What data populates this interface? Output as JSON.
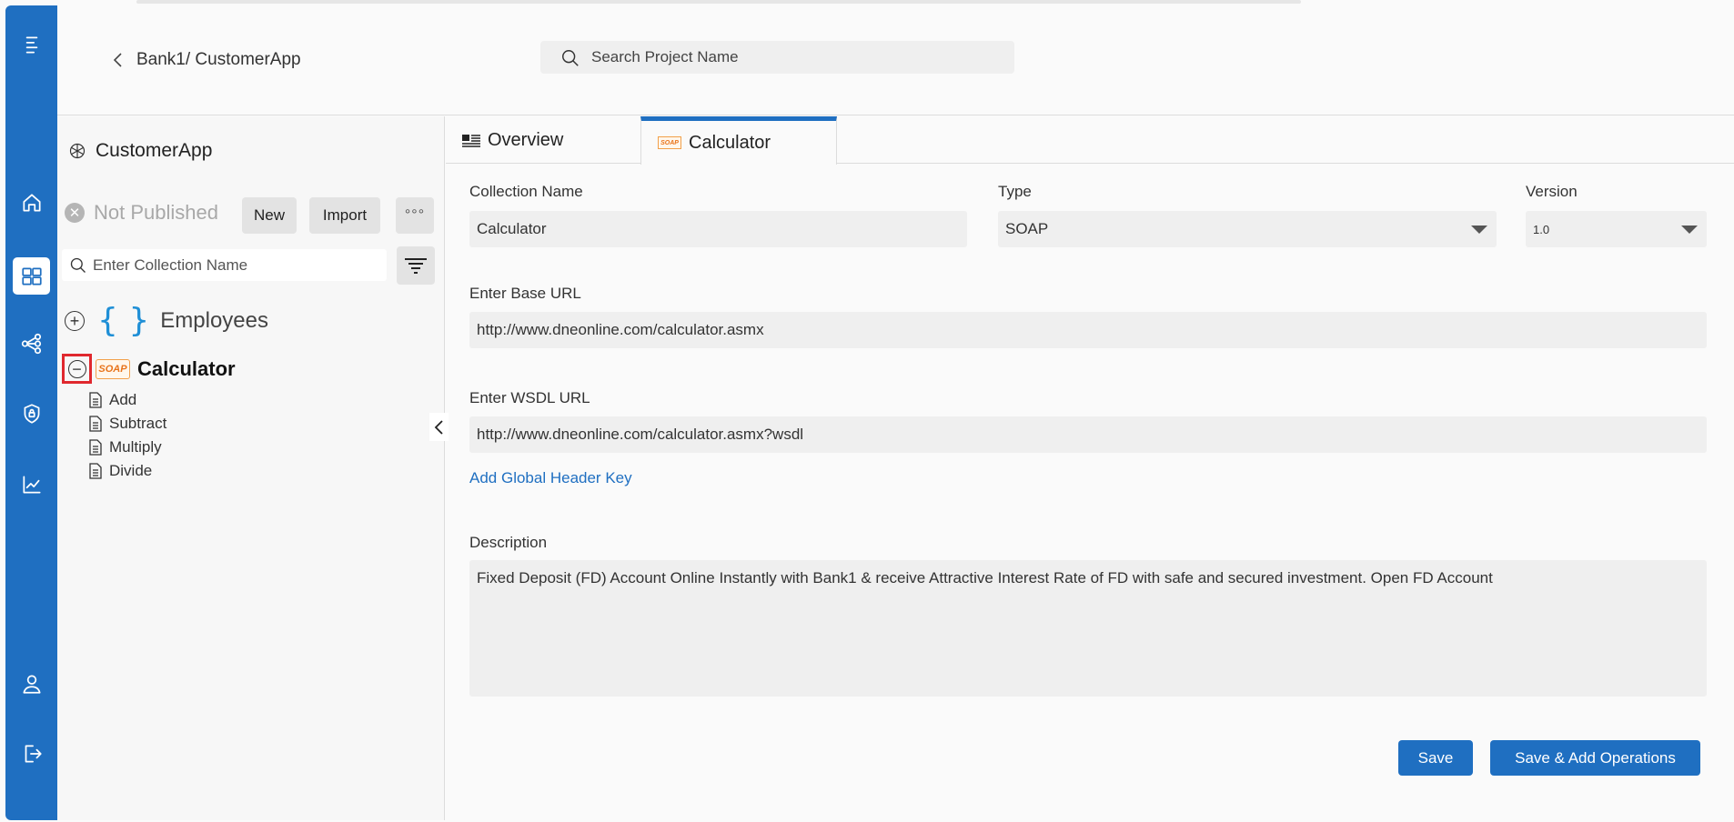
{
  "header": {
    "breadcrumb": "Bank1/ CustomerApp",
    "search_placeholder": "Search Project Name"
  },
  "rail": {
    "icons": [
      "menu-icon",
      "home-icon",
      "dashboard-icon",
      "share-icon",
      "shield-icon",
      "chart-icon",
      "user-icon",
      "logout-icon"
    ],
    "active": "dashboard-icon",
    "color": "#1f6fc1"
  },
  "project": {
    "name": "CustomerApp",
    "status": "Not Published",
    "new_label": "New",
    "import_label": "Import",
    "more_label": "°°°",
    "collection_search_placeholder": "Enter Collection Name"
  },
  "tree": {
    "employees": {
      "icon": "{ }",
      "label": "Employees"
    },
    "calculator": {
      "badge": "SOAP",
      "label": "Calculator",
      "operations": [
        "Add",
        "Subtract",
        "Multiply",
        "Divide"
      ]
    }
  },
  "tabs": {
    "overview": "Overview",
    "calculator": "Calculator",
    "soap_badge": "SOAP"
  },
  "form": {
    "collection_name_label": "Collection Name",
    "collection_name_value": "Calculator",
    "type_label": "Type",
    "type_value": "SOAP",
    "version_label": "Version",
    "version_value": "1.0",
    "base_url_label": "Enter Base URL",
    "base_url_value": "http://www.dneonline.com/calculator.asmx",
    "wsdl_url_label": "Enter WSDL URL",
    "wsdl_url_value": "http://www.dneonline.com/calculator.asmx?wsdl",
    "add_header_link": "Add Global Header Key",
    "description_label": "Description",
    "description_value": "Fixed Deposit (FD) Account Online Instantly with  Bank1 & receive Attractive Interest Rate of FD with safe and secured investment. Open FD Account",
    "save_label": "Save",
    "save_add_label": "Save & Add Operations"
  }
}
